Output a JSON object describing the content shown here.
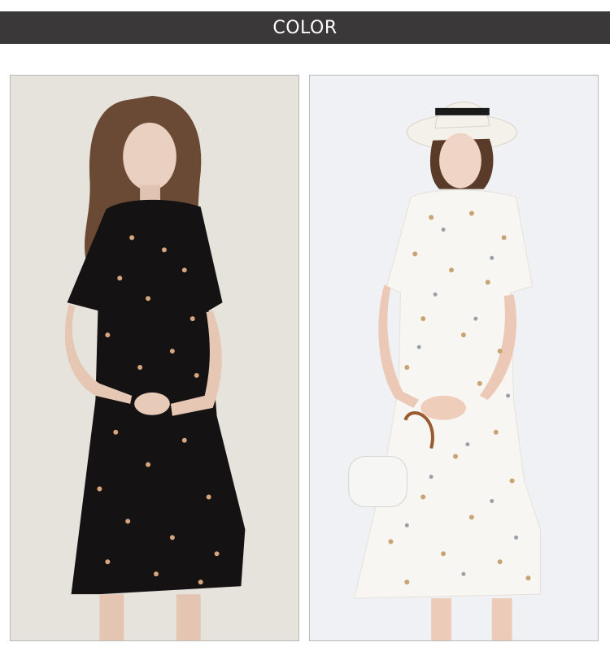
{
  "header": {
    "title": "COLOR"
  },
  "products": [
    {
      "variant": "black floral dress",
      "background_color": "#e6e3dc",
      "dress_color": "#141213",
      "flower_color": "#d9a57c"
    },
    {
      "variant": "white floral dress",
      "background_color": "#f0f1f5",
      "dress_color": "#f8f6f2",
      "flower_color": "#c9a371"
    }
  ]
}
